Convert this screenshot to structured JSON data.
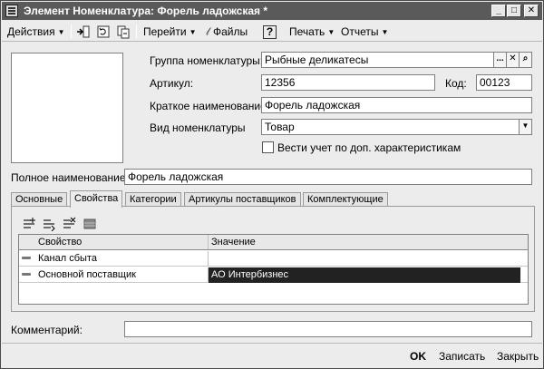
{
  "window": {
    "title": "Элемент Номенклатура: Форель ладожская *",
    "minimize": "_",
    "maximize": "□",
    "close": "✕"
  },
  "toolbar": {
    "actions": "Действия",
    "goto": "Перейти",
    "files": "Файлы",
    "help": "?",
    "print": "Печать",
    "reports": "Отчеты"
  },
  "form": {
    "group_label": "Группа номенклатуры:",
    "group_value": "Рыбные деликатесы",
    "article_label": "Артикул:",
    "article_value": "12356",
    "code_label": "Код:",
    "code_value": "00123",
    "short_name_label": "Краткое наименование:",
    "short_name_value": "Форель ладожская",
    "kind_label": "Вид номенклатуры",
    "kind_value": "Товар",
    "extra_char_label": "Вести учет по доп.  характеристикам",
    "extra_char_checked": false,
    "full_name_label": "Полное наименование:",
    "full_name_value": "Форель ладожская",
    "comment_label": "Комментарий:",
    "comment_value": ""
  },
  "tabs": [
    {
      "label": "Основные",
      "active": false
    },
    {
      "label": "Свойства",
      "active": true
    },
    {
      "label": "Категории",
      "active": false
    },
    {
      "label": "Артикулы поставщиков",
      "active": false
    },
    {
      "label": "Комплектующие",
      "active": false
    }
  ],
  "grid": {
    "columns": [
      "Свойство",
      "Значение"
    ],
    "rows": [
      {
        "property": "Канал сбыта",
        "value": ""
      },
      {
        "property": "Основной поставщик",
        "value": "АО Интербизнес",
        "selected": true
      }
    ]
  },
  "bottom": {
    "ok": "OK",
    "save": "Записать",
    "close": "Закрыть"
  }
}
